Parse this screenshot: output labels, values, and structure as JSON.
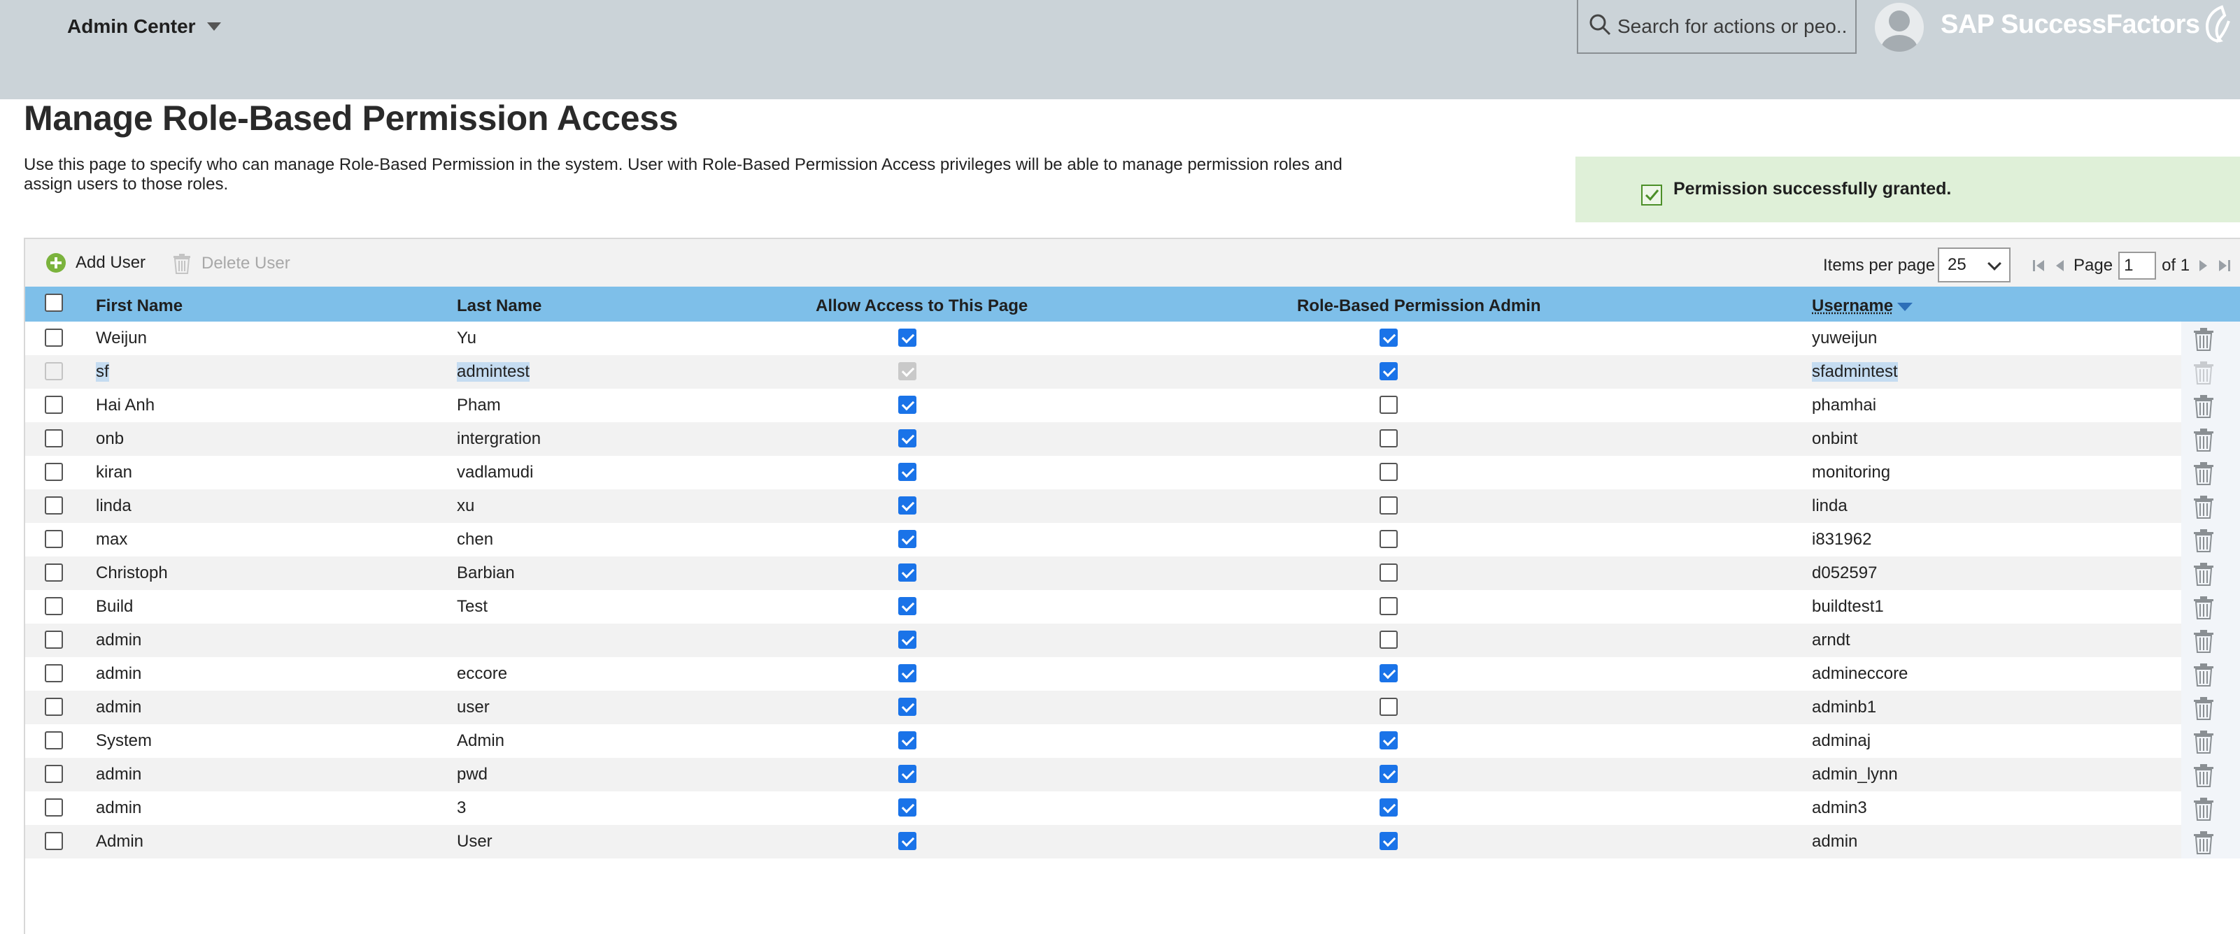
{
  "header": {
    "app_menu": "Admin Center",
    "search_placeholder": "Search for actions or peo...",
    "brand": "SAP SuccessFactors"
  },
  "page": {
    "title": "Manage Role-Based Permission Access",
    "description_line1": "Use this page to specify who can manage Role-Based Permission in the system. User with Role-Based Permission Access privileges will be able to manage permission roles and",
    "description_line2": "assign users to those roles.",
    "success_message": "Permission successfully granted."
  },
  "toolbar": {
    "add_user": "Add User",
    "delete_user": "Delete User",
    "items_per_page_label": "Items per page",
    "items_per_page_value": "25",
    "page_label": "Page",
    "page_value": "1",
    "of_label": "of 1"
  },
  "table": {
    "columns": {
      "first_name": "First Name",
      "last_name": "Last Name",
      "allow_access": "Allow Access to This Page",
      "rbp_admin": "Role-Based Permission Admin",
      "username": "Username"
    },
    "rows": [
      {
        "first": "Weijun",
        "last": "Yu",
        "access": true,
        "admin": true,
        "user": "yuweijun"
      },
      {
        "first": "sf",
        "last": "admintest",
        "access": true,
        "admin": true,
        "user": "sfadmintest"
      },
      {
        "first": "Hai Anh",
        "last": "Pham",
        "access": true,
        "admin": false,
        "user": "phamhai"
      },
      {
        "first": "onb",
        "last": "intergration",
        "access": true,
        "admin": false,
        "user": "onbint"
      },
      {
        "first": "kiran",
        "last": "vadlamudi",
        "access": true,
        "admin": false,
        "user": "monitoring"
      },
      {
        "first": "linda",
        "last": "xu",
        "access": true,
        "admin": false,
        "user": "linda"
      },
      {
        "first": "max",
        "last": "chen",
        "access": true,
        "admin": false,
        "user": "i831962"
      },
      {
        "first": "Christoph",
        "last": "Barbian",
        "access": true,
        "admin": false,
        "user": "d052597"
      },
      {
        "first": "Build",
        "last": "Test",
        "access": true,
        "admin": false,
        "user": "buildtest1"
      },
      {
        "first": "admin",
        "last": "",
        "access": true,
        "admin": false,
        "user": "arndt"
      },
      {
        "first": "admin",
        "last": "eccore",
        "access": true,
        "admin": true,
        "user": "admineccore"
      },
      {
        "first": "admin",
        "last": "user",
        "access": true,
        "admin": false,
        "user": "adminb1"
      },
      {
        "first": "System",
        "last": "Admin",
        "access": true,
        "admin": true,
        "user": "adminaj"
      },
      {
        "first": "admin",
        "last": "pwd",
        "access": true,
        "admin": true,
        "user": "admin_lynn"
      },
      {
        "first": "admin",
        "last": "3",
        "access": true,
        "admin": true,
        "user": "admin3"
      },
      {
        "first": "Admin",
        "last": "User",
        "access": true,
        "admin": true,
        "user": "admin"
      }
    ]
  }
}
